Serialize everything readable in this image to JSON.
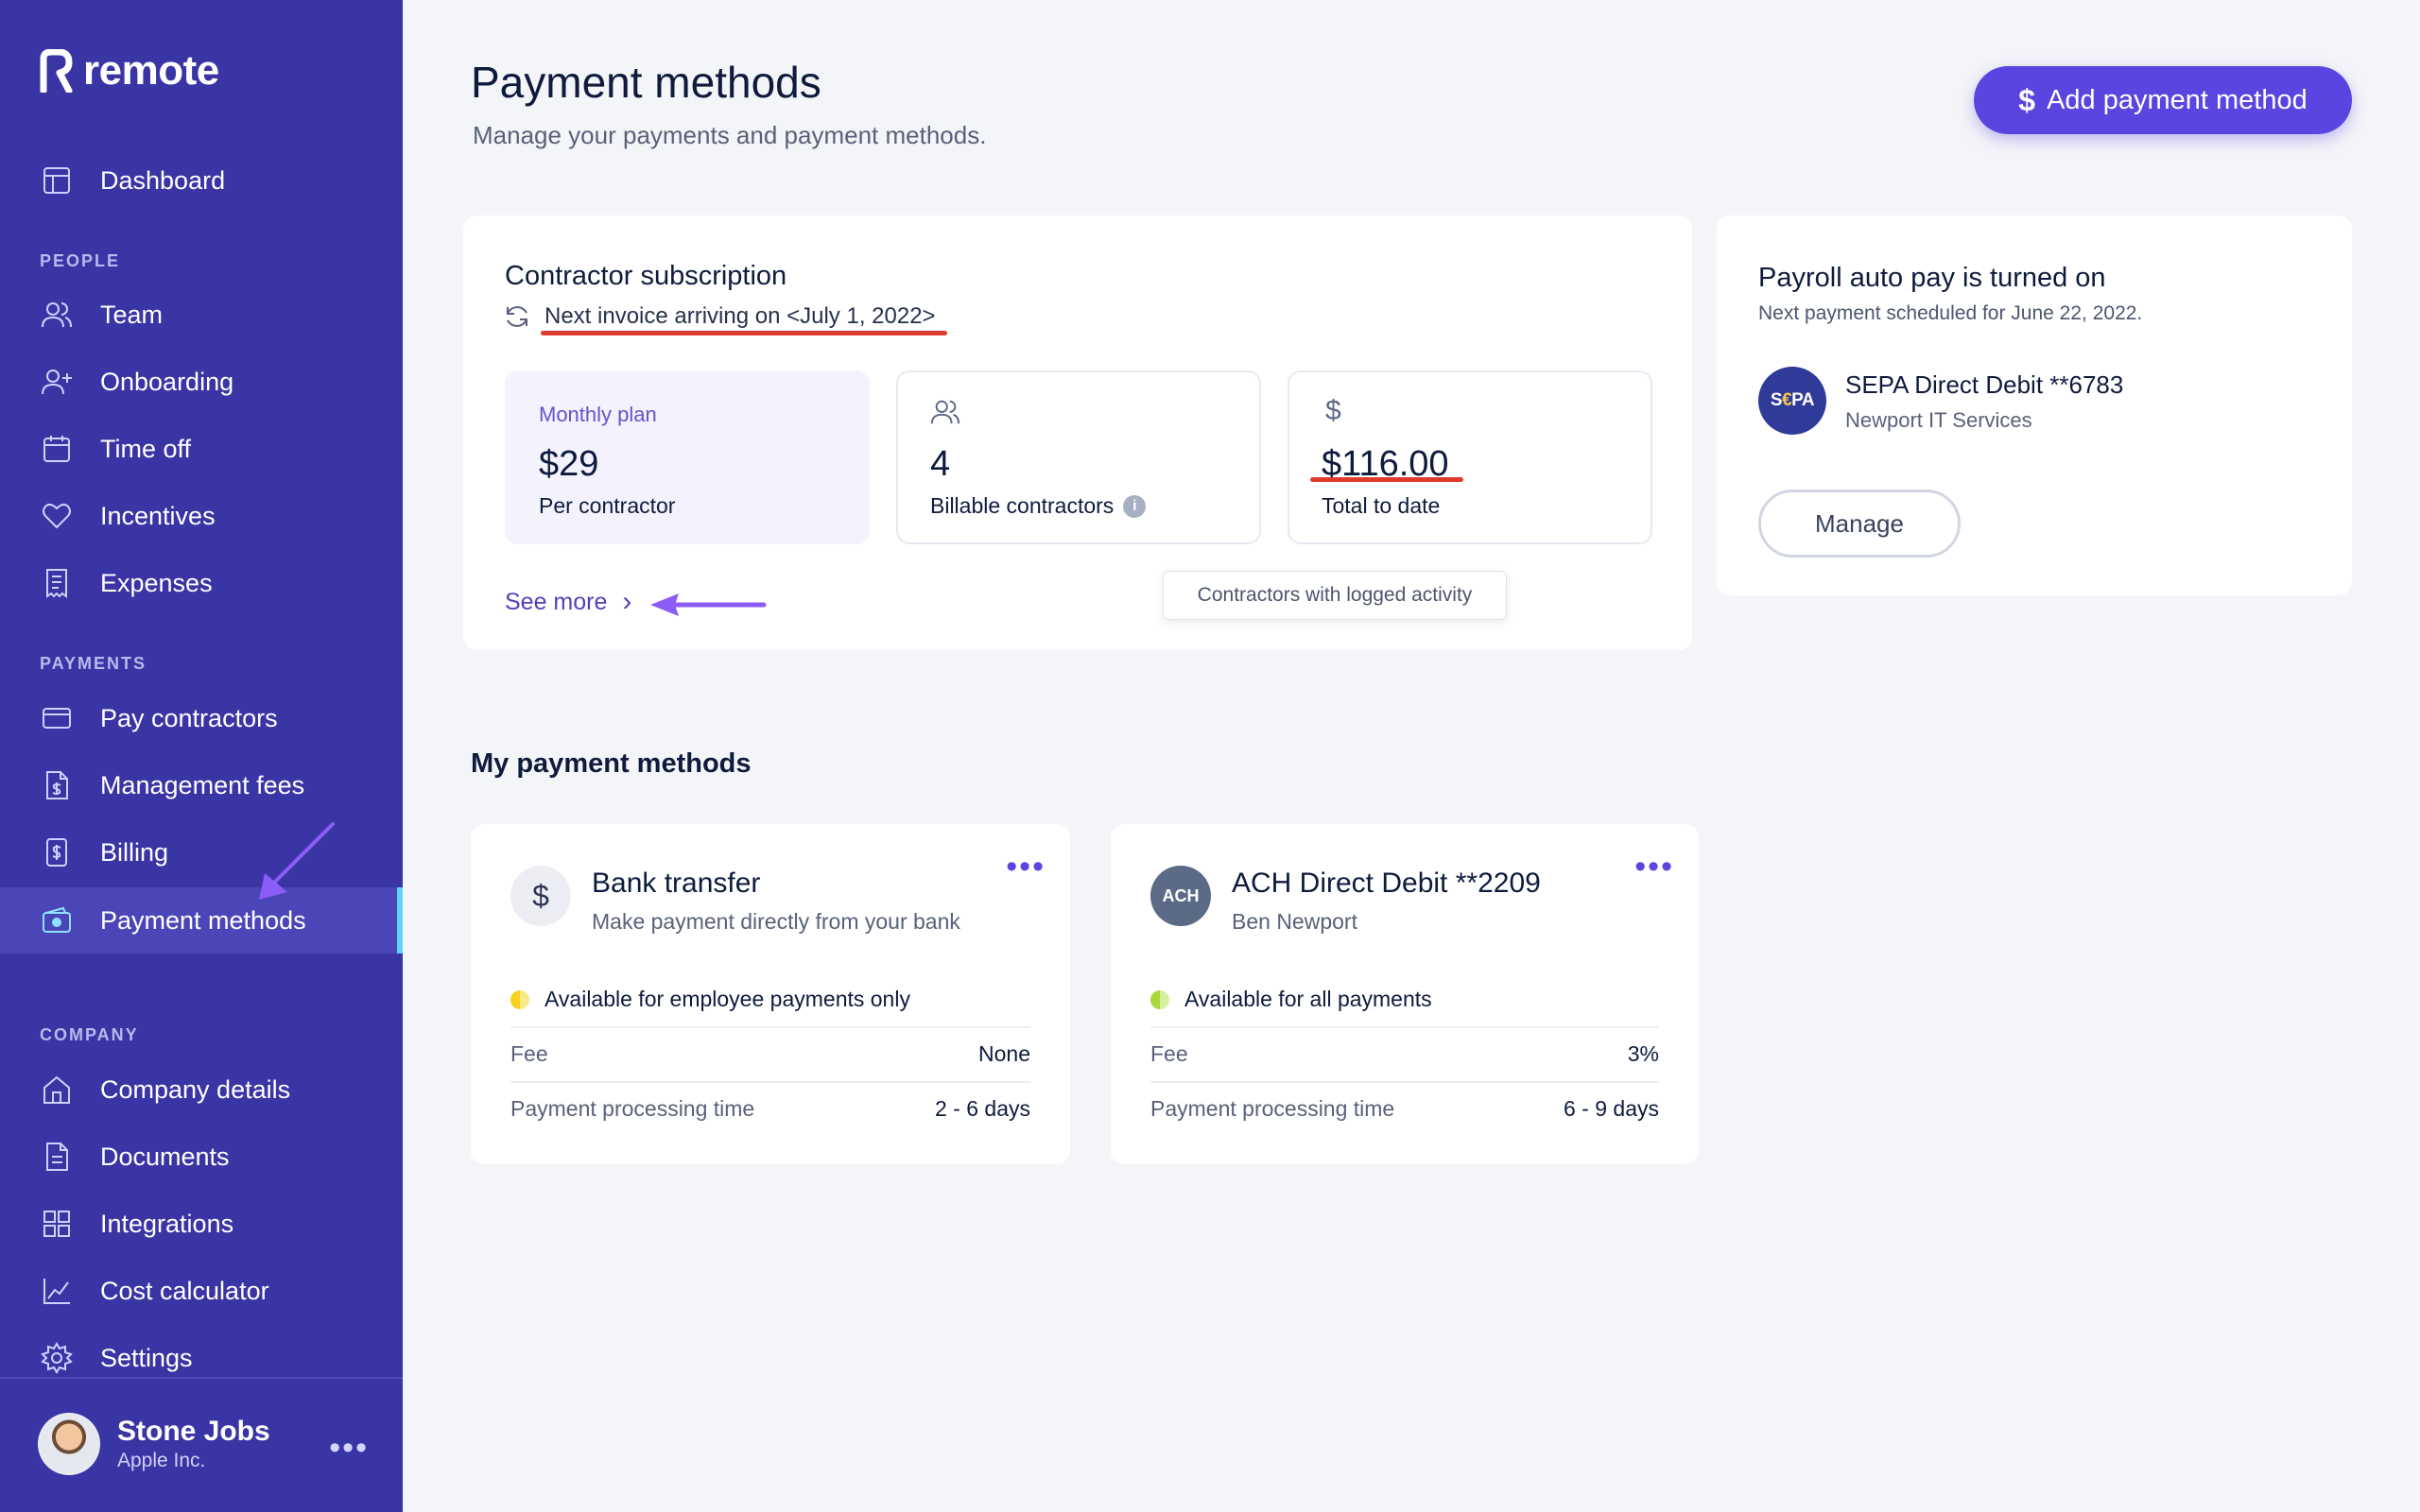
{
  "brand": {
    "name": "remote",
    "accent": "#5b45e0",
    "sidebar_bg": "#3a35a4"
  },
  "sidebar": {
    "dashboard": "Dashboard",
    "people_label": "PEOPLE",
    "team": "Team",
    "onboarding": "Onboarding",
    "time_off": "Time off",
    "incentives": "Incentives",
    "expenses": "Expenses",
    "payments_label": "PAYMENTS",
    "pay_contractors": "Pay contractors",
    "management_fees": "Management fees",
    "billing": "Billing",
    "payment_methods": "Payment methods",
    "company_label": "COMPANY",
    "company_details": "Company details",
    "documents": "Documents",
    "integrations": "Integrations",
    "cost_calculator": "Cost calculator",
    "settings": "Settings",
    "active_item": "Payment methods"
  },
  "user": {
    "name": "Stone Jobs",
    "org": "Apple Inc.",
    "more": "•••"
  },
  "header": {
    "title": "Payment methods",
    "subtitle": "Manage your payments and payment methods.",
    "add_button": "Add payment method",
    "add_icon": "$"
  },
  "subscription": {
    "title": "Contractor subscription",
    "next_invoice": "Next invoice arriving on <July 1, 2022>",
    "plan_label": "Monthly plan",
    "plan_value": "$29",
    "plan_caption": "Per contractor",
    "billable_value": "4",
    "billable_caption": "Billable contractors",
    "total_icon": "$",
    "total_value": "$116.00",
    "total_caption": "Total to date",
    "see_more": "See more",
    "tooltip": "Contractors with logged activity"
  },
  "payroll": {
    "title": "Payroll auto pay is turned on",
    "subtitle": "Next payment scheduled for June 22, 2022.",
    "logo_text_a": "S",
    "logo_text_euro": "€",
    "logo_text_b": "PA",
    "method": "SEPA Direct Debit **6783",
    "org": "Newport IT Services",
    "manage": "Manage"
  },
  "my_methods": {
    "title": "My payment methods",
    "items": [
      {
        "icon": "$",
        "name": "Bank transfer",
        "desc": "Make payment directly from your bank",
        "status": "Available for employee payments only",
        "fee_label": "Fee",
        "fee": "None",
        "time_label": "Payment processing time",
        "time": "2 - 6 days"
      },
      {
        "icon": "ACH",
        "name": "ACH Direct Debit **2209",
        "desc": "Ben Newport",
        "status": "Available for all payments",
        "fee_label": "Fee",
        "fee": "3%",
        "time_label": "Payment processing time",
        "time": "6 - 9 days"
      }
    ],
    "more": "•••"
  }
}
